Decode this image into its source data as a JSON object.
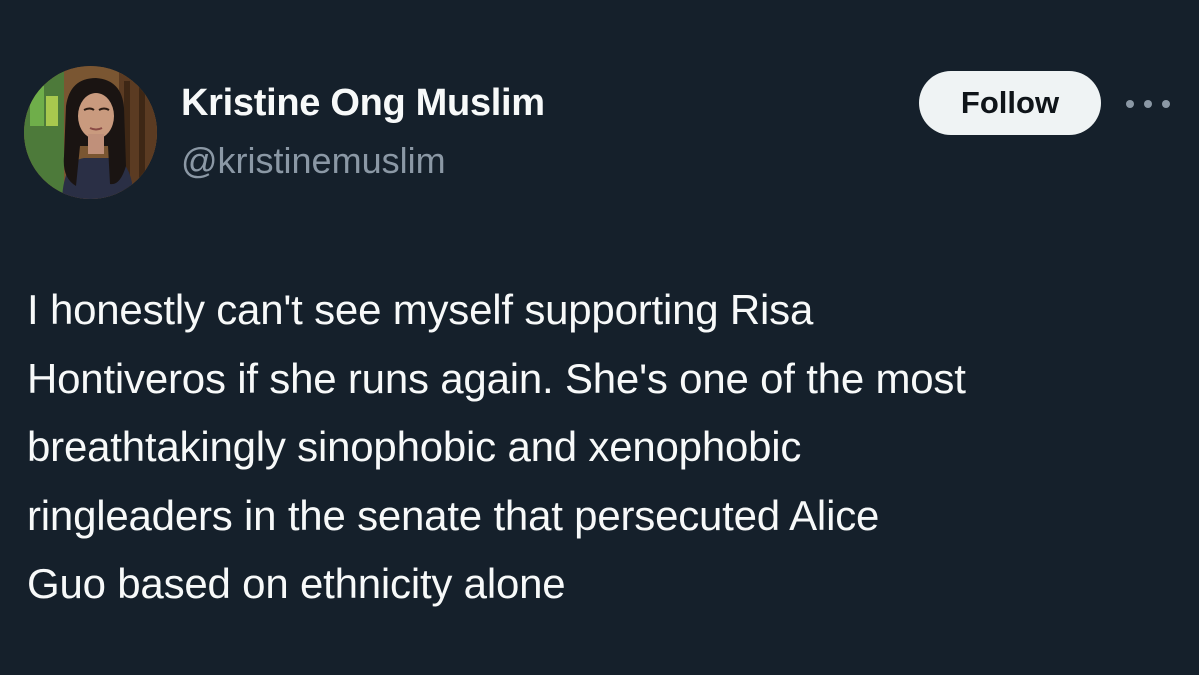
{
  "user": {
    "display_name": "Kristine Ong Muslim",
    "handle": "@kristinemuslim"
  },
  "actions": {
    "follow_label": "Follow",
    "more_icon": "more-horizontal-icon"
  },
  "tweet": {
    "lines": [
      "I honestly can't see myself supporting Risa",
      "Hontiveros if she runs again. She's one of the most",
      "breathtakingly sinophobic and xenophobic",
      "ringleaders in the senate that persecuted Alice",
      "Guo based on ethnicity alone"
    ]
  },
  "colors": {
    "background": "#15202b",
    "text": "#f7f9f9",
    "secondary_text": "#8b98a5",
    "follow_button_bg": "#eff3f4"
  }
}
